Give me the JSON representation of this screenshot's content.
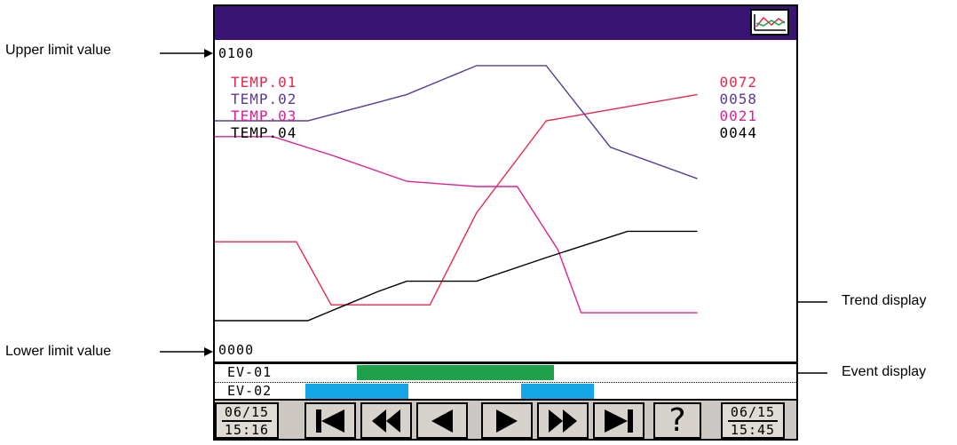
{
  "callouts": {
    "upper_limit": "Upper limit value",
    "lower_limit": "Lower limit value",
    "trend_display": "Trend display",
    "event_display": "Event display"
  },
  "screen": {
    "title_icon": "trend-graph-icon",
    "upper_limit_value": "0100",
    "lower_limit_value": "0000",
    "colors": {
      "titlebar": "#3a1473"
    }
  },
  "chart_data": {
    "type": "line",
    "ylim": [
      0,
      100
    ],
    "series": [
      {
        "name": "TEMP.01",
        "current": "0072",
        "color": "#e8284a",
        "points": [
          [
            0,
            30
          ],
          [
            14,
            30
          ],
          [
            20,
            6
          ],
          [
            37,
            6
          ],
          [
            45,
            41
          ],
          [
            57,
            76
          ],
          [
            83,
            86
          ]
        ]
      },
      {
        "name": "TEMP.02",
        "current": "0058",
        "color": "#5a3b94",
        "points": [
          [
            0,
            76
          ],
          [
            16,
            76
          ],
          [
            28,
            83
          ],
          [
            33,
            86
          ],
          [
            45,
            97
          ],
          [
            57,
            97
          ],
          [
            68,
            66
          ],
          [
            83,
            54
          ]
        ]
      },
      {
        "name": "TEMP.03",
        "current": "0021",
        "color": "#e01f92",
        "points": [
          [
            0,
            70
          ],
          [
            10,
            70
          ],
          [
            20,
            63
          ],
          [
            33,
            53
          ],
          [
            45,
            51
          ],
          [
            52,
            51
          ],
          [
            59,
            27
          ],
          [
            63,
            3
          ],
          [
            83,
            3
          ]
        ]
      },
      {
        "name": "TEMP.04",
        "current": "0044",
        "color": "#000000",
        "points": [
          [
            0,
            0
          ],
          [
            16,
            0
          ],
          [
            28,
            11
          ],
          [
            33,
            15
          ],
          [
            45,
            15
          ],
          [
            57,
            24
          ],
          [
            71,
            34
          ],
          [
            83,
            34
          ]
        ]
      }
    ]
  },
  "events": [
    {
      "label": "EV-01",
      "color": "#1fa04b",
      "segments": [
        [
          24.4,
          58.3
        ]
      ]
    },
    {
      "label": "EV-02",
      "color": "#14a5e6",
      "segments": [
        [
          15.5,
          33.3
        ],
        [
          52.7,
          65.2
        ]
      ]
    }
  ],
  "controls": {
    "start": {
      "date": "06/15",
      "time": "15:16"
    },
    "end": {
      "date": "06/15",
      "time": "15:45"
    },
    "buttons": [
      "skip-to-start-icon",
      "fast-rewind-icon",
      "step-back-icon",
      "step-forward-icon",
      "fast-forward-icon",
      "skip-to-end-icon",
      "help-icon"
    ],
    "help_glyph": "?"
  }
}
